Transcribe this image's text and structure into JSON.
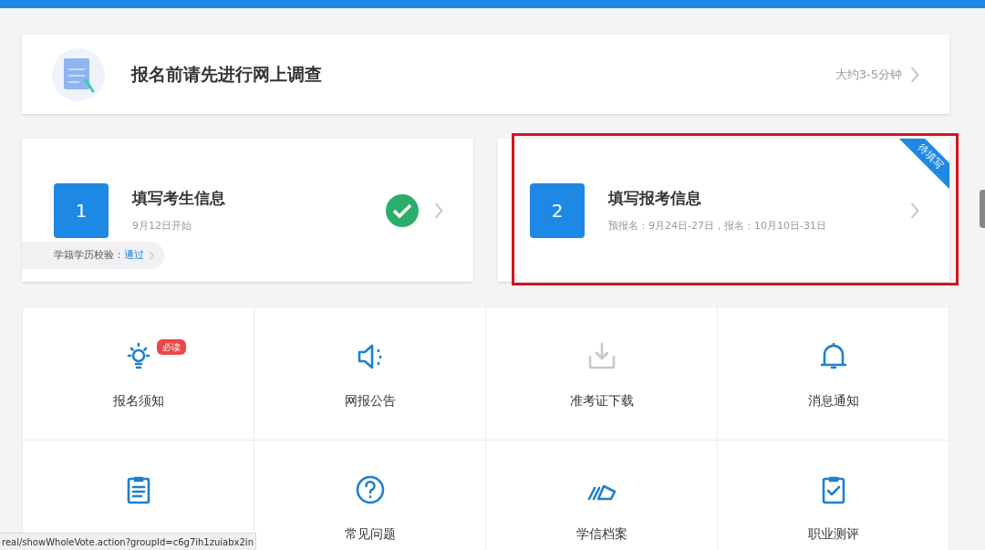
{
  "survey": {
    "title": "报名前请先进行网上调查",
    "duration": "大约3-5分钟"
  },
  "steps": [
    {
      "number": "1",
      "title": "填写考生信息",
      "subtitle": "9月12日开始",
      "completed": true,
      "highlighted": false,
      "check": {
        "label": "学籍学历校验：",
        "result": "通过"
      }
    },
    {
      "number": "2",
      "title": "填写报考信息",
      "subtitle": "预报名：9月24日-27日，报名：10月10日-31日",
      "completed": false,
      "ribbon": "待填写",
      "highlighted": true
    }
  ],
  "tiles": [
    {
      "label": "报名须知",
      "badge": "必读",
      "disabled": false
    },
    {
      "label": "网报公告",
      "disabled": false
    },
    {
      "label": "准考证下载",
      "disabled": true
    },
    {
      "label": "消息通知",
      "disabled": false
    },
    {
      "disabled": false
    },
    {
      "label": "常见问题",
      "disabled": false
    },
    {
      "label": "学信档案",
      "disabled": false
    },
    {
      "label": "职业测评",
      "disabled": false
    }
  ],
  "status_bar": {
    "url": "real/showWholeVote.action?groupId=c6g7ih1zuiabx2in"
  }
}
